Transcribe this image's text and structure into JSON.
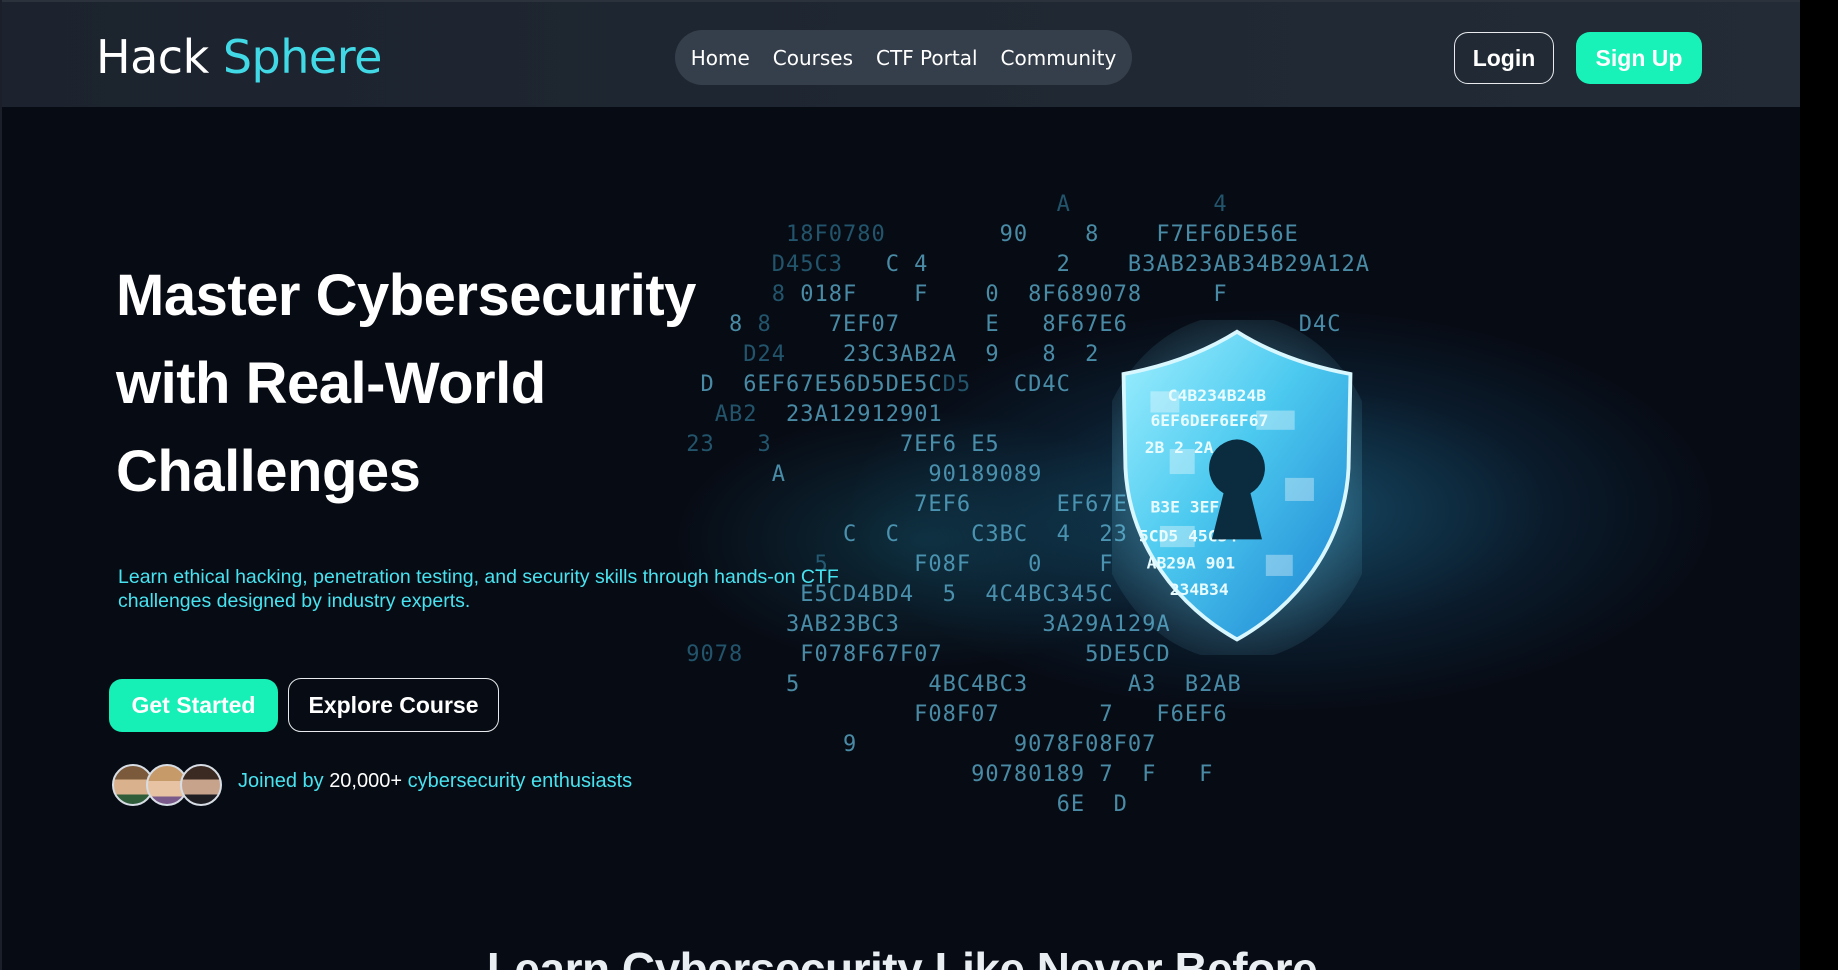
{
  "brand": {
    "name_main": "Hack",
    "name_accent": "Sphere",
    "accent_color": "#42d9e6"
  },
  "nav": {
    "items": [
      "Home",
      "Courses",
      "CTF Portal",
      "Community"
    ]
  },
  "auth": {
    "login_label": "Login",
    "signup_label": "Sign Up",
    "signup_color": "#18f2b9"
  },
  "hero": {
    "headline_lines": [
      "Master Cybersecurity",
      "with Real-World",
      "Challenges"
    ],
    "subtitle": "Learn ethical hacking, penetration testing, and security skills through hands-on CTF challenges designed by industry experts.",
    "primary_cta": "Get Started",
    "secondary_cta": "Explore Course",
    "social_proof_prefix": "Joined by",
    "social_proof_count": "20,000+",
    "social_proof_suffix": "cybersecurity enthusiasts",
    "illustration_icon": "shield-keyhole-icon"
  },
  "next_section": {
    "title": "Learn Cybersecurity Like Never Before"
  }
}
